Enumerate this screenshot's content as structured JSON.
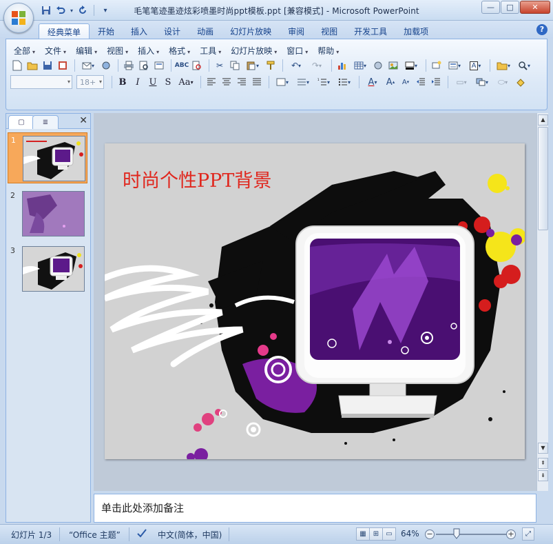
{
  "window": {
    "title": "毛笔笔迹墨迹炫彩喷墨时尚ppt模板.ppt [兼容模式] - Microsoft PowerPoint",
    "min_label": "—",
    "max_label": "□",
    "close_label": "✕"
  },
  "quick_access": [
    {
      "icon": "save-icon",
      "glyph": "💾"
    },
    {
      "icon": "undo-icon",
      "glyph": "↶"
    },
    {
      "icon": "dropdown-icon",
      "glyph": "▾"
    },
    {
      "icon": "redo-icon",
      "glyph": "↻"
    },
    {
      "icon": "customize-icon",
      "glyph": "="
    }
  ],
  "ribbon_tabs": [
    "经典菜单",
    "开始",
    "插入",
    "设计",
    "动画",
    "幻灯片放映",
    "审阅",
    "视图",
    "开发工具",
    "加载项"
  ],
  "active_tab": "经典菜单",
  "classic_menu": [
    "全部",
    "文件",
    "编辑",
    "视图",
    "插入",
    "格式",
    "工具",
    "幻灯片放映",
    "窗口",
    "帮助"
  ],
  "font": {
    "name_value": "",
    "size_value": "18+"
  },
  "format_buttons": [
    "B",
    "I",
    "U",
    "S",
    "Aa"
  ],
  "left_pane": {
    "tab_slides": "▢",
    "tab_outline": "≣",
    "close": "✕",
    "thumbnails": [
      {
        "number": "1",
        "selected": true
      },
      {
        "number": "2",
        "selected": false
      },
      {
        "number": "3",
        "selected": false
      }
    ]
  },
  "slide": {
    "title": "时尚个性PPT背景"
  },
  "notes": {
    "placeholder": "单击此处添加备注"
  },
  "status": {
    "slide_counter": "幻灯片 1/3",
    "theme": "“Office 主题”",
    "language": "中文(简体，中国)",
    "zoom": "64%"
  },
  "colors": {
    "title_red": "#e0271e",
    "ribbon_blue": "#15428b",
    "selected_thumb": "#f7a85a"
  }
}
